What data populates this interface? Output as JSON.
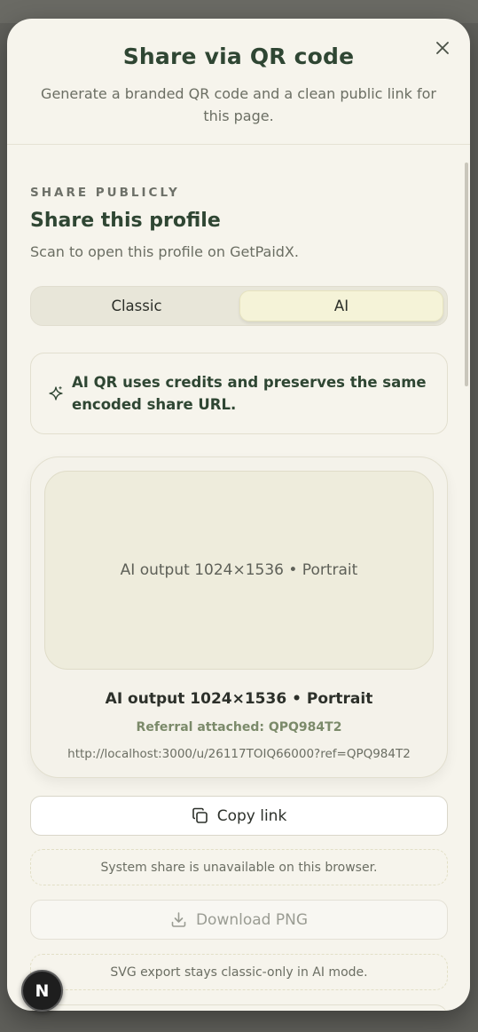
{
  "modal": {
    "title": "Share via QR code",
    "subtitle": "Generate a branded QR code and a clean public link for this page.",
    "close_label": "×"
  },
  "section": {
    "eyebrow": "SHARE PUBLICLY",
    "title": "Share this profile",
    "subtitle": "Scan to open this profile on GetPaidX."
  },
  "mode_toggle": {
    "options": [
      "Classic",
      "AI"
    ],
    "selected": "AI"
  },
  "notice": {
    "icon": "sparkle-icon",
    "text": "AI QR uses credits and preserves the same encoded share URL."
  },
  "preview": {
    "placeholder_label": "AI output 1024×1536 • Portrait",
    "caption": "AI output 1024×1536 • Portrait",
    "referral": "Referral attached: QPQ984T2",
    "share_url": "http://localhost:3000/u/26117TOIQ66000?ref=QPQ984T2"
  },
  "actions": {
    "copy_label": "Copy link",
    "copy_icon": "copy-icon",
    "share_unavailable": "System share is unavailable on this browser.",
    "download_label": "Download PNG",
    "download_icon": "download-icon",
    "svg_note": "SVG export stays classic-only in AI mode."
  },
  "fab": {
    "label": "N"
  },
  "colors": {
    "accent_green": "#2f4633",
    "referral_green": "#7b8a6a",
    "surface": "#f6f4ec",
    "toggle_active": "#f5f3d8"
  }
}
